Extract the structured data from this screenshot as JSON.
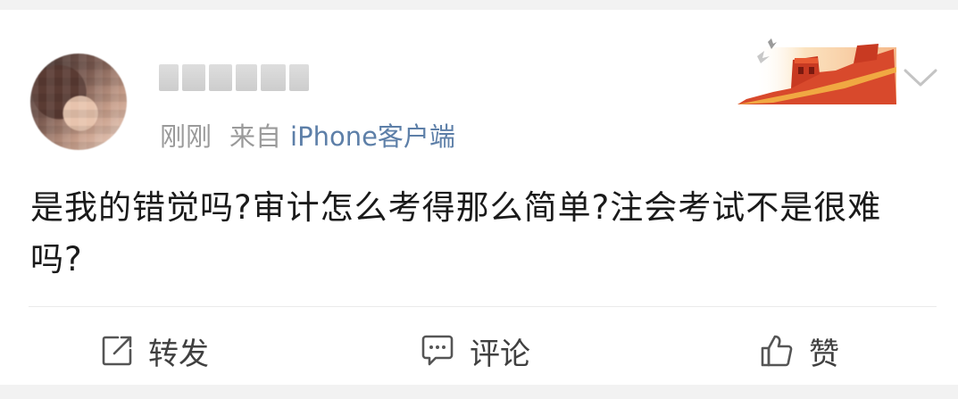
{
  "post": {
    "time": "刚刚",
    "from_label": "来自",
    "source": "iPhone客户端",
    "text": "是我的错觉吗?审计怎么考得那么简单?注会考试不是很难吗?"
  },
  "actions": {
    "repost_label": "转发",
    "comment_label": "评论",
    "like_label": "赞"
  },
  "icons": {
    "more": "chevron-down-icon",
    "repost": "share-box-icon",
    "comment": "speech-bubble-icon",
    "like": "thumbs-up-icon"
  },
  "colors": {
    "link": "#5d7fa8",
    "meta": "#9a9a9a",
    "text": "#1a1a1a",
    "background": "#f2f2f2"
  }
}
